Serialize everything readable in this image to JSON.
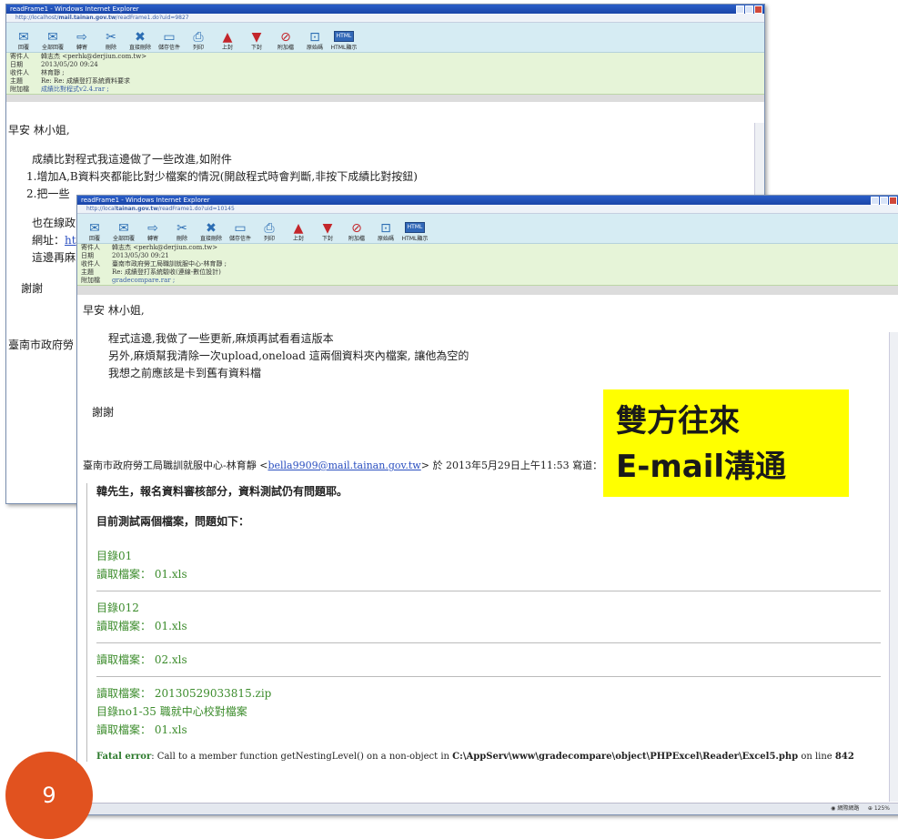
{
  "back_window": {
    "title": "readFrame1 - Windows Internet Explorer",
    "address_prefix": "http://localhost/",
    "address_host": "mail.tainan.gov.tw",
    "address_path": "/readFrame1.do?uid=9827",
    "header": {
      "from_label": "寄件人",
      "from_value": "韓志杰 <perhk@derjiun.com.tw>",
      "date_label": "日期",
      "date_value": "2013/05/20 09:24",
      "to_label": "收件人",
      "to_value": "林育靜 ;",
      "subject_label": "主題",
      "subject_value": "Re: Re: 成績登打系統資料要求",
      "attach_label": "附加檔",
      "attach_value": "成績比對程式v2.4.rar ;"
    },
    "greeting": "早安  林小姐,",
    "lines": [
      "成績比對程式我這邊做了一些改進,如附件",
      "1.增加A,B資料夾都能比對少檔案的情況(開啟程式時會判斷,非按下成績比對按鈕)",
      "2.把一些",
      "也在線政",
      "網址：",
      "ht",
      "這邊再麻",
      "謝謝",
      "臺南市政府勞"
    ]
  },
  "toolbar": {
    "items": [
      {
        "label": "回覆",
        "icon": "✉"
      },
      {
        "label": "全部回覆",
        "icon": "✉"
      },
      {
        "label": "轉寄",
        "icon": "⇨"
      },
      {
        "label": "刪除",
        "icon": "✂"
      },
      {
        "label": "直接刪除",
        "icon": "✖"
      },
      {
        "label": "儲存信件",
        "icon": "▭"
      },
      {
        "label": "列印",
        "icon": "⎙"
      },
      {
        "label": "上封",
        "icon": "▲"
      },
      {
        "label": "下封",
        "icon": "▼"
      },
      {
        "label": "附加檔",
        "icon": "⊘"
      },
      {
        "label": "原始碼",
        "icon": "⊡"
      },
      {
        "label": "HTML顯示",
        "icon": "HTML"
      }
    ]
  },
  "front_window": {
    "title": "readFrame1 - Windows Internet Explorer",
    "address_prefix": "http://local",
    "address_host": "tainan.gov.tw",
    "address_path": "/readFrame1.do?uid=10145",
    "header": {
      "from_label": "寄件人",
      "from_value": "韓志杰 <perhk@derjiun.com.tw>",
      "date_label": "日期",
      "date_value": "2013/05/30 09:21",
      "to_label": "收件人",
      "to_value": "臺南市政府勞工局職訓就服中心-林育靜 ;",
      "subject_label": "主題",
      "subject_value": "Re: 成績登打系統驗收(連線-數位設計)",
      "attach_label": "附加檔",
      "attach_value": "gradecompare.rar ;"
    },
    "greeting": "早安  林小姐,",
    "body": [
      "程式這邊,我做了一些更新,麻煩再試看看這版本",
      "另外,麻煩幫我清除一次upload,oneload 這兩個資料夾內檔案, 讓他為空的",
      "我想之前應該是卡到舊有資料檔"
    ],
    "thanks": "謝謝",
    "quote_prefix": "臺南市政府勞工局職訓就服中心-林育靜 <",
    "quote_email": "bella9909@mail.tainan.gov.tw",
    "quote_suffix": "> 於 2013年5月29日上午11:53 寫道：",
    "quote_line1": "韓先生，報名資料審核部分，資料測試仍有問題耶。",
    "quote_line2": "目前測試兩個檔案，問題如下：",
    "sections": [
      [
        "目錄01",
        "讀取檔案： 01.xls"
      ],
      [
        "目錄012",
        "讀取檔案： 01.xls"
      ],
      [
        "讀取檔案： 02.xls"
      ],
      [
        "讀取檔案： 20130529033815.zip",
        "目錄no1-35 職就中心校對檔案",
        "讀取檔案： 01.xls"
      ]
    ],
    "fatal_label": "Fatal error",
    "fatal_text": ": Call to a member function getNestingLevel() on a non-object in ",
    "fatal_path": "C:\\AppServ\\www\\gradecompare\\object\\PHPExcel\\Reader\\Excel5.php",
    "fatal_mid": " on line ",
    "fatal_line": "842",
    "status_zone": "網際網路",
    "status_zoom": "125%"
  },
  "callout": {
    "line1": "雙方往來",
    "line2": "E-mail溝通"
  },
  "slide_number": "9"
}
